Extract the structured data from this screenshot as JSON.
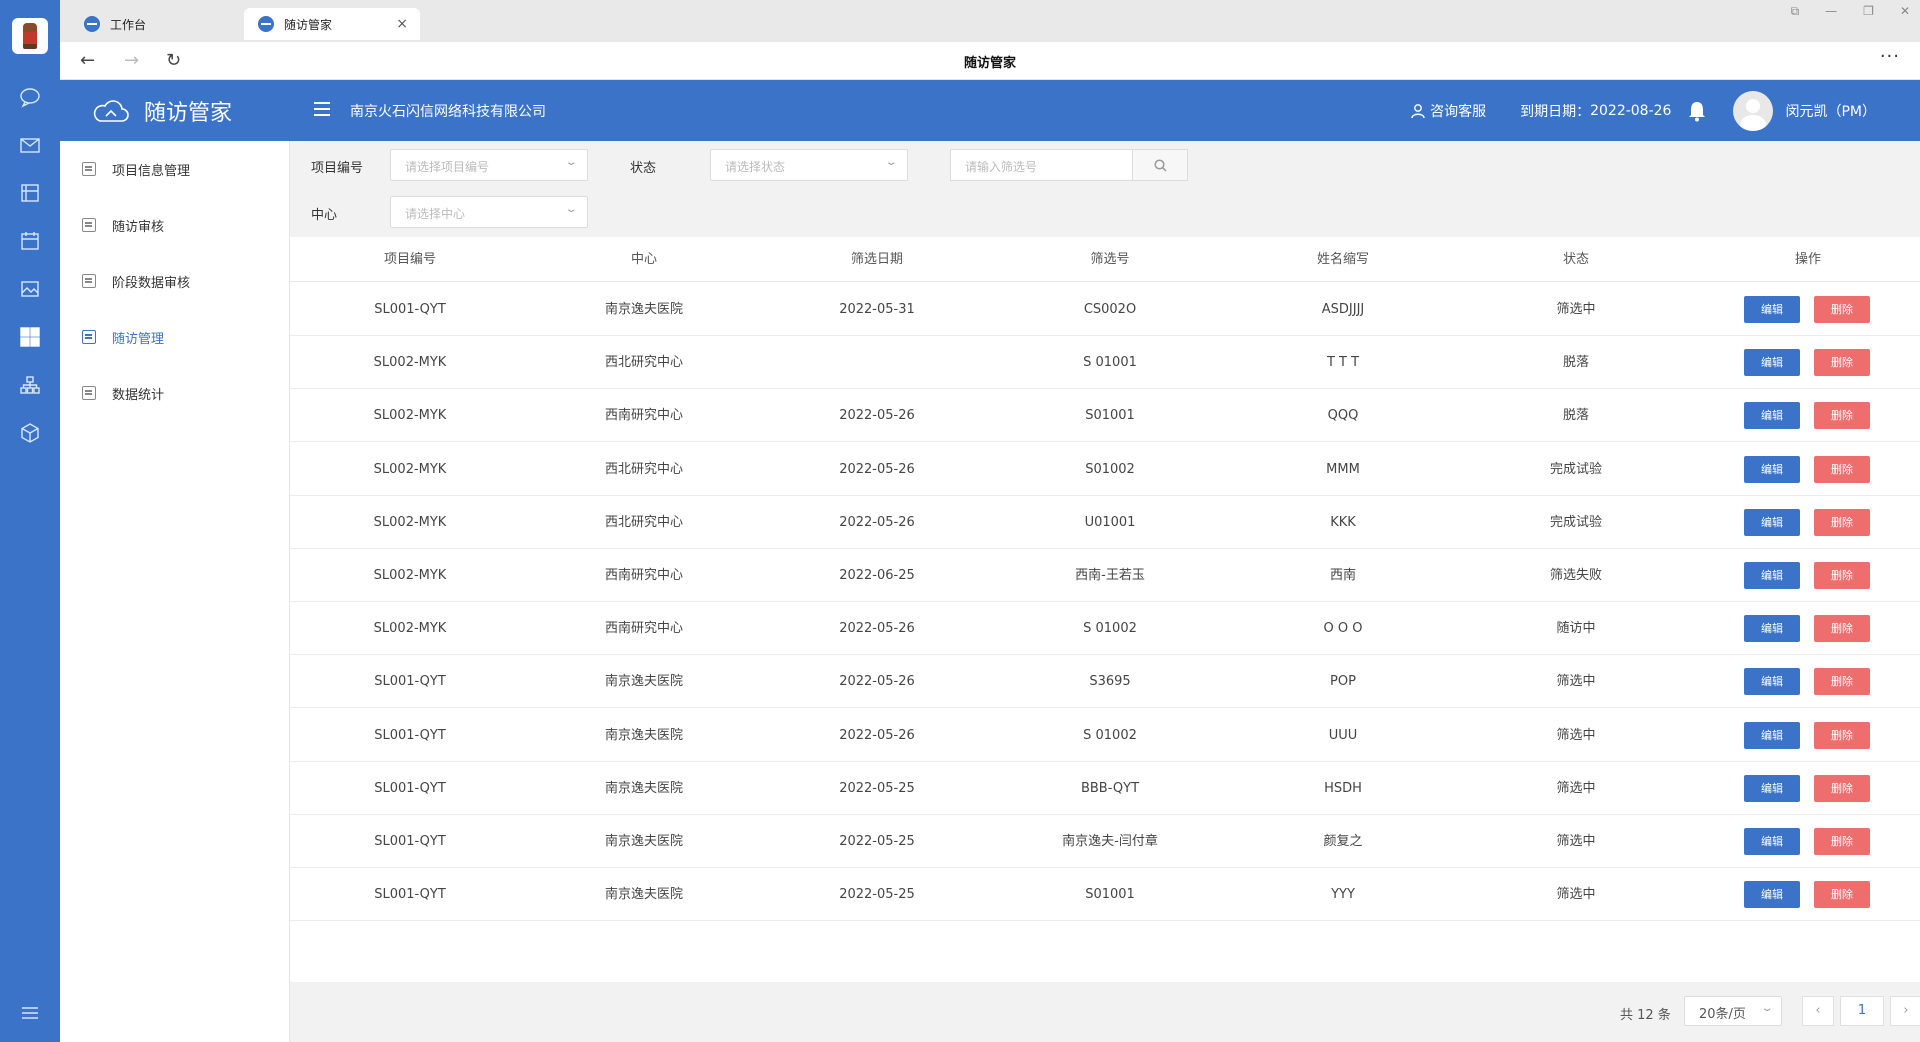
{
  "browser": {
    "tabs": [
      {
        "label": "工作台"
      },
      {
        "label": "随访管家",
        "close": "×"
      }
    ],
    "page_title": "随访管家",
    "more": "···"
  },
  "header": {
    "brand": "随访管家",
    "company": "南京火石闪信网络科技有限公司",
    "service": "咨询客服",
    "expiry_label": "到期日期：",
    "expiry_date": "2022-08-26",
    "user": "闵元凯（PM）",
    "accent_color": "#3a73c8"
  },
  "sidebar": {
    "items": [
      {
        "label": "项目信息管理",
        "icon": "grid-icon"
      },
      {
        "label": "随访审核",
        "icon": "document-icon"
      },
      {
        "label": "阶段数据审核",
        "icon": "document-icon"
      },
      {
        "label": "随访管理",
        "icon": "calendar-icon",
        "active": true
      },
      {
        "label": "数据统计",
        "icon": "chart-icon"
      }
    ]
  },
  "filters": {
    "project_label": "项目编号",
    "project_placeholder": "请选择项目编号",
    "status_label": "状态",
    "status_placeholder": "请选择状态",
    "screen_placeholder": "请输入筛选号",
    "center_label": "中心",
    "center_placeholder": "请选择中心"
  },
  "table": {
    "columns": [
      "项目编号",
      "中心",
      "筛选日期",
      "筛选号",
      "姓名缩写",
      "状态",
      "操作"
    ],
    "edit_label": "编辑",
    "delete_label": "删除",
    "rows": [
      [
        "SL001-QYT",
        "南京逸夫医院",
        "2022-05-31",
        "CS002O",
        "ASDJJJJ",
        "筛选中"
      ],
      [
        "SL002-MYK",
        "西北研究中心",
        "",
        "S 01001",
        "T T T",
        "脱落"
      ],
      [
        "SL002-MYK",
        "西南研究中心",
        "2022-05-26",
        "S01001",
        "QQQ",
        "脱落"
      ],
      [
        "SL002-MYK",
        "西北研究中心",
        "2022-05-26",
        "S01002",
        "MMM",
        "完成试验"
      ],
      [
        "SL002-MYK",
        "西北研究中心",
        "2022-05-26",
        "U01001",
        "KKK",
        "完成试验"
      ],
      [
        "SL002-MYK",
        "西南研究中心",
        "2022-06-25",
        "西南-王若玉",
        "西南",
        "筛选失败"
      ],
      [
        "SL002-MYK",
        "西南研究中心",
        "2022-05-26",
        "S 01002",
        "O O O",
        "随访中"
      ],
      [
        "SL001-QYT",
        "南京逸夫医院",
        "2022-05-26",
        "S3695",
        "POP",
        "筛选中"
      ],
      [
        "SL001-QYT",
        "南京逸夫医院",
        "2022-05-26",
        "S 01002",
        "UUU",
        "筛选中"
      ],
      [
        "SL001-QYT",
        "南京逸夫医院",
        "2022-05-25",
        "BBB-QYT",
        "HSDH",
        "筛选中"
      ],
      [
        "SL001-QYT",
        "南京逸夫医院",
        "2022-05-25",
        "南京逸夫-闫付章",
        "颜复之",
        "筛选中"
      ],
      [
        "SL001-QYT",
        "南京逸夫医院",
        "2022-05-25",
        "S01001",
        "YYY",
        "筛选中"
      ]
    ]
  },
  "pager": {
    "total": "共 12 条",
    "page_size": "20条/页",
    "prev": "‹",
    "current": "1",
    "next": "›"
  }
}
